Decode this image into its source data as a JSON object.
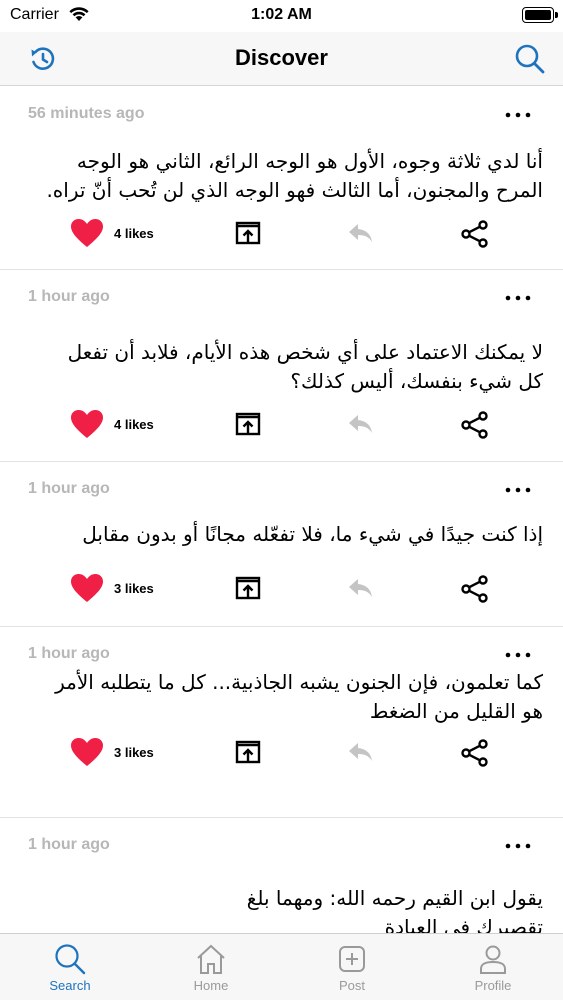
{
  "status": {
    "carrier": "Carrier",
    "time": "1:02 AM"
  },
  "header": {
    "title": "Discover",
    "left_icon": "refresh-clock-icon",
    "right_icon": "search-icon"
  },
  "colors": {
    "accent": "#1e73be",
    "heart": "#f01f46",
    "muted": "#b7b7b7"
  },
  "posts": [
    {
      "time": "56 minutes ago",
      "text": "أنا لدي ثلاثة وجوه، الأول هو الوجه الرائع، الثاني هو الوجه المرح والمجنون، أما الثالث فهو الوجه الذي لن تُحب أنّ تراه.",
      "likes": "4 likes"
    },
    {
      "time": "1 hour ago",
      "text": "لا يمكنك الاعتماد على أي شخص هذه الأيام، فلابد أن تفعل كل شيء بنفسك، أليس كذلك؟",
      "likes": "4 likes"
    },
    {
      "time": "1 hour ago",
      "text": "إذا كنت جيدًا في شيء ما، فلا تفعّله مجانًا أو بدون مقابل",
      "likes": "3 likes"
    },
    {
      "time": "1 hour ago",
      "text": "كما تعلمون، فإن الجنون يشبه الجاذبية... كل ما يتطلبه الأمر هو القليل من الضغط",
      "likes": "3 likes"
    },
    {
      "time": "1 hour ago",
      "text": "يقول ابن القيم رحمه الله: ومهما بلغ تقصيرك في العبادة",
      "likes": ""
    }
  ],
  "tabs": [
    {
      "label": "Search",
      "icon": "search-icon",
      "active": true
    },
    {
      "label": "Home",
      "icon": "home-icon",
      "active": false
    },
    {
      "label": "Post",
      "icon": "plus-square-icon",
      "active": false
    },
    {
      "label": "Profile",
      "icon": "person-icon",
      "active": false
    }
  ]
}
